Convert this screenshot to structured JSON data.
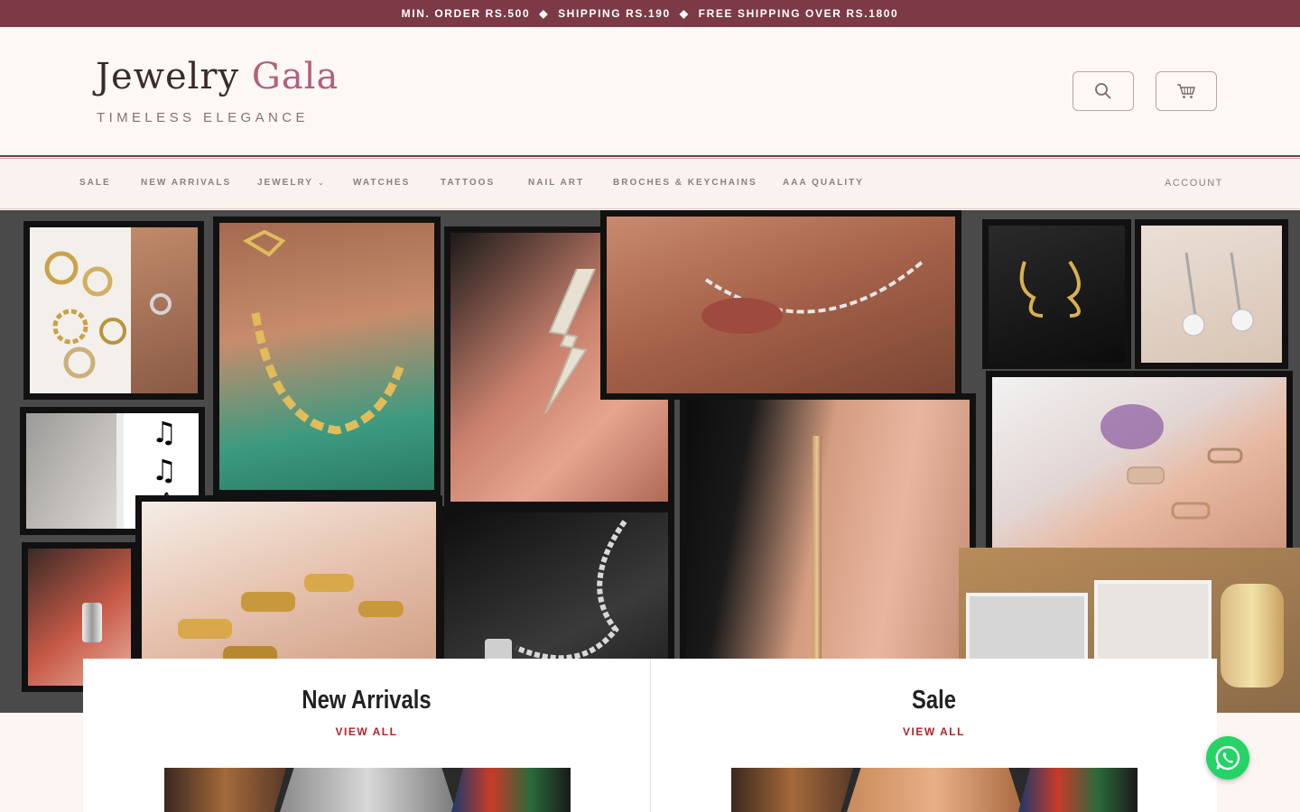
{
  "announcement": {
    "part1": "MIN. ORDER RS.500",
    "part2": "SHIPPING RS.190",
    "part3": "FREE SHIPPING OVER RS.1800",
    "separator": "◆"
  },
  "header": {
    "logo_main": "Jewelry",
    "logo_accent": "Gala",
    "tagline": "TIMELESS ELEGANCE",
    "search_icon": "search-icon",
    "cart_icon": "cart-icon"
  },
  "nav": {
    "items": [
      "SALE",
      "NEW ARRIVALS",
      "JEWELRY",
      "WATCHES",
      "TATTOOS",
      "NAIL ART",
      "BROCHES & KEYCHAINS",
      "AAA QUALITY"
    ],
    "dropdown_chevron": "⌄",
    "account": "ACCOUNT"
  },
  "collections": [
    {
      "title": "New Arrivals",
      "link": "VIEW ALL"
    },
    {
      "title": "Sale",
      "link": "VIEW ALL"
    }
  ],
  "colors": {
    "announcement_bg": "#7b3a45",
    "logo_accent": "#b3607a",
    "link_red": "#b0242c",
    "whatsapp_green": "#25d366"
  }
}
